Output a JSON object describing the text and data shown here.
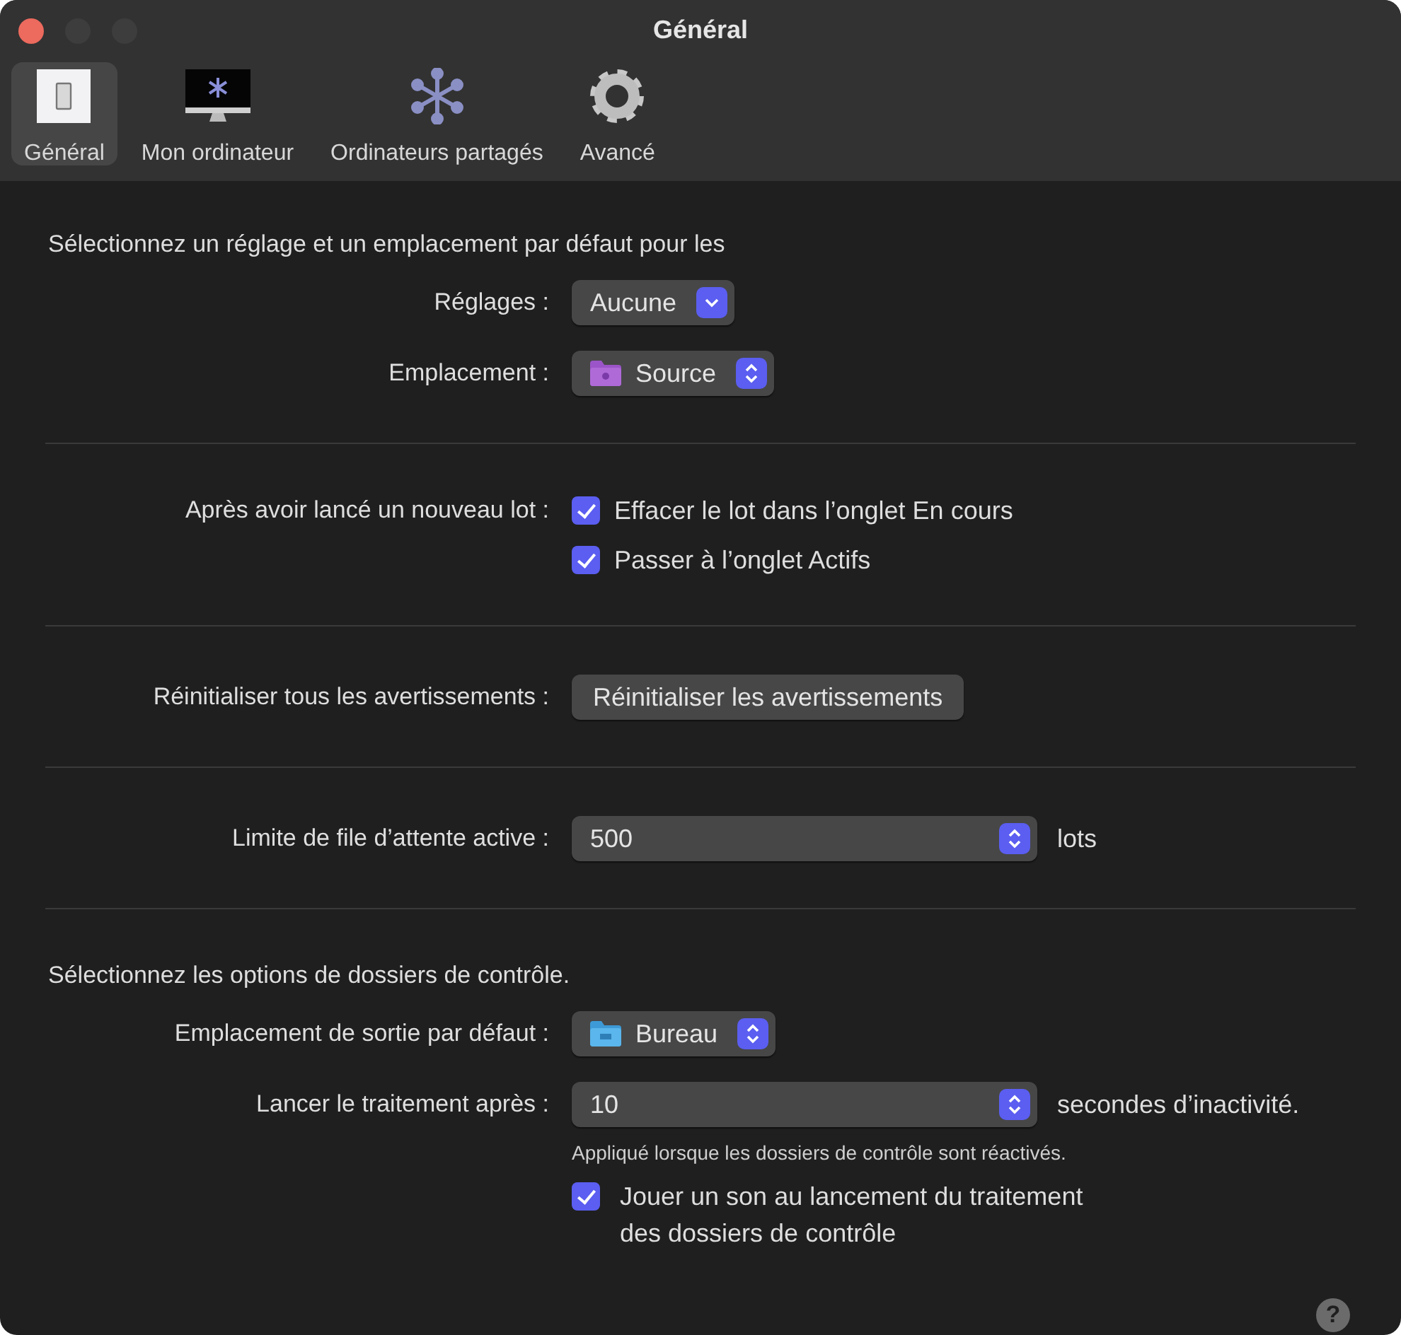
{
  "window": {
    "title": "Général"
  },
  "tabs": [
    {
      "label": "Général",
      "selected": true
    },
    {
      "label": "Mon ordinateur",
      "selected": false
    },
    {
      "label": "Ordinateurs partagés",
      "selected": false
    },
    {
      "label": "Avancé",
      "selected": false
    }
  ],
  "sections": [
    {
      "heading": "Sélectionnez un réglage et un emplacement par défaut pour les",
      "rows": [
        {
          "kind": "pulldown",
          "label": "Réglages :",
          "value": "Aucune"
        },
        {
          "kind": "folder-popup",
          "label": "Emplacement :",
          "value": "Source"
        }
      ]
    },
    {
      "rows": [
        {
          "kind": "checkbox",
          "label": "Après avoir lancé un nouveau lot :",
          "text": "Effacer le lot dans l’onglet En cours",
          "checked": true
        },
        {
          "kind": "checkbox",
          "text": "Passer à l’onglet Actifs",
          "checked": true
        }
      ]
    },
    {
      "rows": [
        {
          "kind": "button",
          "label": "Réinitialiser tous les avertissements :",
          "text": "Réinitialiser les avertissements"
        }
      ]
    },
    {
      "rows": [
        {
          "kind": "number-popup",
          "label": "Limite de file d’attente active :",
          "value": "500",
          "suffix": "lots"
        }
      ]
    },
    {
      "heading": "Sélectionnez les options de dossiers de contrôle.",
      "rows": [
        {
          "kind": "folder-popup",
          "label": "Emplacement de sortie par défaut :",
          "value": "Bureau"
        },
        {
          "kind": "number-popup",
          "label": "Lancer le traitement après :",
          "value": "10",
          "suffix": "secondes d’inactivité."
        },
        {
          "kind": "note",
          "text": "Appliqué lorsque les dossiers de contrôle sont réactivés."
        },
        {
          "kind": "checkbox",
          "text": "Jouer un son au lancement du traitement\ndes dossiers de contrôle",
          "checked": true
        }
      ]
    }
  ],
  "help": "?"
}
